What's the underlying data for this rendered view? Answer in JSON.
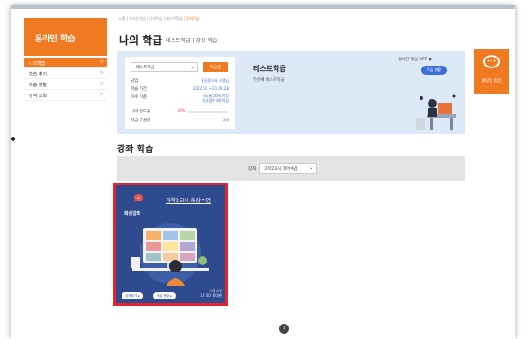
{
  "sidebar": {
    "title": "온라인 학습",
    "items": [
      {
        "label": "나의학습",
        "active": true
      },
      {
        "label": "학습 찾기",
        "active": false
      },
      {
        "label": "학습 현황",
        "active": false
      },
      {
        "label": "성적 조회",
        "active": false
      }
    ]
  },
  "breadcrumb": {
    "home": "⌂ 홈",
    "items": [
      "온라인학습",
      "나의학습",
      "테스트학급"
    ],
    "current": "강좌학습",
    "separator": "|"
  },
  "header": {
    "title": "나의 학급",
    "subtitle": "테스트학급  |  강좌 학습"
  },
  "course_info": {
    "class_select_value": "테스트학급",
    "select_button": "학급을",
    "rows": [
      {
        "label": "담임",
        "value": "홍길동교사 선생님"
      },
      {
        "label": "학습 기간",
        "value": "2022.01 ~ 21.02.28"
      },
      {
        "label": "이수 기준",
        "value": "진도율 50% 이상\n평균점수 60 이상"
      },
      {
        "label": "나의 진도율",
        "value": "0%"
      },
      {
        "label": "학급 구성원",
        "value": "3명"
      }
    ],
    "progress_percent": 0,
    "course_name": "테스트학급",
    "professor": "두번째 테스트학급",
    "realtime_label": "실시간 화상  OFF ◉",
    "realtime_button": "학습 현황"
  },
  "chat_button": {
    "label": "채팅방 입장"
  },
  "lectures": {
    "section_title": "강좌 학습",
    "filter_label": "강좌",
    "filter_value": "과학2교시 영어수업",
    "card": {
      "badge": "ON",
      "title": "과학2교시 화상수업",
      "tag": "화상강좌",
      "button_left": "강의하기 ▸",
      "button_right": "학습 현황 ▸",
      "start_label": "시작시간",
      "start_time": "17:30 (60분)"
    }
  },
  "pager": {
    "current_page": "1"
  },
  "colors": {
    "accent": "#f07a22",
    "panel_bg": "#dde9f6",
    "card_bg": "#2f4b8f",
    "highlight_border": "#e8232b",
    "link_blue": "#3a6fc7"
  }
}
